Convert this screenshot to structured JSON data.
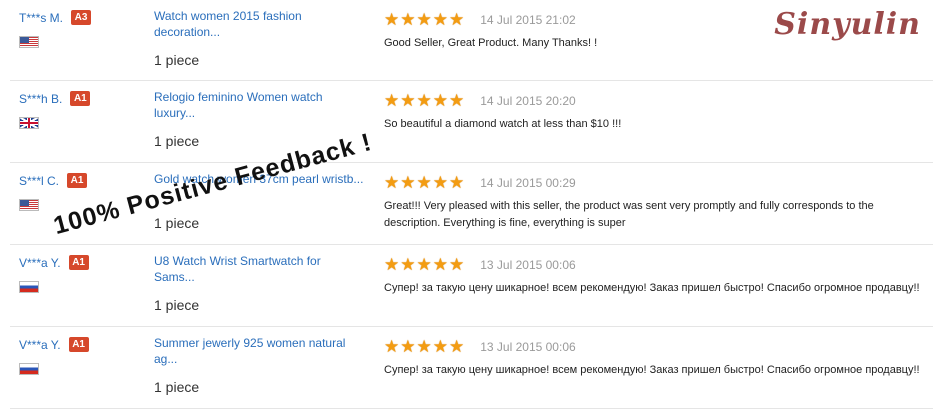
{
  "shop": {
    "logo_text": "Sinyulin"
  },
  "overlay": {
    "text": "100% Positive Feedback !"
  },
  "colors": {
    "star": "#f39c12",
    "badge": "#d6482b",
    "link": "#2a6ebb",
    "date": "#9a9a9a"
  },
  "icons": {
    "star": "star-icon",
    "flag_us": "us-flag-icon",
    "flag_uk": "uk-flag-icon",
    "flag_ru": "ru-flag-icon"
  },
  "star_glyph": "★",
  "feedback": [
    {
      "buyer": "T***s M.",
      "level": "A3",
      "country": "us",
      "product": "Watch women 2015 fashion decoration...",
      "quantity": "1 piece",
      "rating": 5,
      "date": "14 Jul 2015 21:02",
      "comment": "Good Seller, Great Product. Many Thanks! !"
    },
    {
      "buyer": "S***h B.",
      "level": "A1",
      "country": "uk",
      "product": "Relogio feminino Women watch luxury...",
      "quantity": "1 piece",
      "rating": 5,
      "date": "14 Jul 2015 20:20",
      "comment": "So beautiful a diamond watch at less than $10 !!!"
    },
    {
      "buyer": "S***l C.",
      "level": "A1",
      "country": "us",
      "product": "Gold watch women 37cm pearl wristb...",
      "quantity": "1 piece",
      "rating": 5,
      "date": "14 Jul 2015 00:29",
      "comment": "Great!!! Very pleased with this seller, the product was sent very promptly and fully corresponds to the description. Everything is fine, everything is super"
    },
    {
      "buyer": "V***a Y.",
      "level": "A1",
      "country": "ru",
      "product": "U8 Watch Wrist Smartwatch for Sams...",
      "quantity": "1 piece",
      "rating": 5,
      "date": "13 Jul 2015 00:06",
      "comment": "Супер! за такую цену шикарное! всем рекомендую! Заказ пришел быстро! Спасибо огромное продавцу!!"
    },
    {
      "buyer": "V***a Y.",
      "level": "A1",
      "country": "ru",
      "product": "Summer jewerly 925 women natural ag...",
      "quantity": "1 piece",
      "rating": 5,
      "date": "13 Jul 2015 00:06",
      "comment": "Супер! за такую цену шикарное! всем рекомендую! Заказ пришел быстро! Спасибо огромное продавцу!!"
    }
  ]
}
